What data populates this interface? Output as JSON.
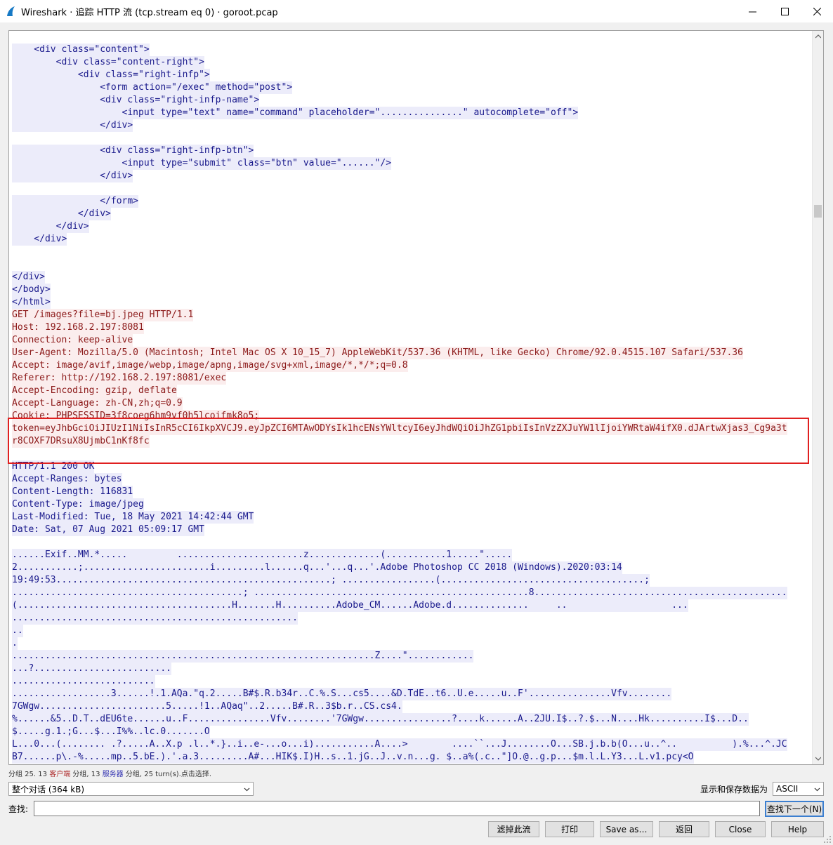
{
  "window": {
    "title": "Wireshark · 追踪 HTTP 流 (tcp.stream eq 0) · goroot.pcap"
  },
  "colors": {
    "server_bg": "#ececfa",
    "server_fg": "#1a1a8c",
    "client_bg": "#fbeded",
    "client_fg": "#8c1a1a",
    "highlight_border": "#e02020"
  },
  "stream": {
    "lines": [
      {
        "t": "s",
        "text": "    <div class=\"content\">"
      },
      {
        "t": "s",
        "text": "        <div class=\"content-right\">"
      },
      {
        "t": "s",
        "text": "            <div class=\"right-infp\">"
      },
      {
        "t": "s",
        "text": "                <form action=\"/exec\" method=\"post\">"
      },
      {
        "t": "s",
        "text": "                <div class=\"right-infp-name\">"
      },
      {
        "t": "s",
        "text": "                    <input type=\"text\" name=\"command\" placeholder=\"...............\" autocomplete=\"off\">"
      },
      {
        "t": "s",
        "text": "                </div>"
      },
      {
        "t": "s",
        "text": ""
      },
      {
        "t": "s",
        "text": "                <div class=\"right-infp-btn\">"
      },
      {
        "t": "s",
        "text": "                    <input type=\"submit\" class=\"btn\" value=\"......\"/>"
      },
      {
        "t": "s",
        "text": "                </div>"
      },
      {
        "t": "s",
        "text": ""
      },
      {
        "t": "s",
        "text": "                </form>"
      },
      {
        "t": "s",
        "text": "            </div>"
      },
      {
        "t": "s",
        "text": "        </div>"
      },
      {
        "t": "s",
        "text": "    </div>"
      },
      {
        "t": "s",
        "text": ""
      },
      {
        "t": "s",
        "text": ""
      },
      {
        "t": "s",
        "text": "</div>"
      },
      {
        "t": "s",
        "text": "</body>"
      },
      {
        "t": "s",
        "text": "</html>"
      },
      {
        "t": "c",
        "text": "GET /images?file=bj.jpeg HTTP/1.1"
      },
      {
        "t": "c",
        "text": "Host: 192.168.2.197:8081"
      },
      {
        "t": "c",
        "text": "Connection: keep-alive"
      },
      {
        "t": "c",
        "text": "User-Agent: Mozilla/5.0 (Macintosh; Intel Mac OS X 10_15_7) AppleWebKit/537.36 (KHTML, like Gecko) Chrome/92.0.4515.107 Safari/537.36"
      },
      {
        "t": "c",
        "text": "Accept: image/avif,image/webp,image/apng,image/svg+xml,image/*,*/*;q=0.8"
      },
      {
        "t": "c",
        "text": "Referer: http://192.168.2.197:8081/exec"
      },
      {
        "t": "c",
        "text": "Accept-Encoding: gzip, deflate"
      },
      {
        "t": "c",
        "text": "Accept-Language: zh-CN,zh;q=0.9"
      },
      {
        "t": "c",
        "text": "Cookie: PHPSESSID=3f8coeg6hm9vf0h5lcoifmk8o5;"
      },
      {
        "t": "c",
        "text": "token=eyJhbGciOiJIUzI1NiIsInR5cCI6IkpXVCJ9.eyJpZCI6MTAwODYsIk1hcENsYWltcyI6eyJhdWQiOiJhZG1pbiIsInVzZXJuYW1lIjoiYWRtaW4ifX0.dJArtwXjas3_Cg9a3t"
      },
      {
        "t": "c",
        "text": "r8COXF7DRsuX8UjmbC1nKf8fc"
      },
      {
        "t": "c",
        "text": ""
      },
      {
        "t": "s",
        "text": "HTTP/1.1 200 OK"
      },
      {
        "t": "s",
        "text": "Accept-Ranges: bytes"
      },
      {
        "t": "s",
        "text": "Content-Length: 116831"
      },
      {
        "t": "s",
        "text": "Content-Type: image/jpeg"
      },
      {
        "t": "s",
        "text": "Last-Modified: Tue, 18 May 2021 14:42:44 GMT"
      },
      {
        "t": "s",
        "text": "Date: Sat, 07 Aug 2021 05:09:17 GMT"
      },
      {
        "t": "s",
        "text": ""
      },
      {
        "t": "s",
        "text": "......Exif..MM.*.....         .......................z.............(...........1.....\"....."
      },
      {
        "t": "s",
        "text": "2...........;.......................i.........l......q...'...q...'.Adobe Photoshop CC 2018 (Windows).2020:03:14"
      },
      {
        "t": "s",
        "text": "19:49:53..................................................; .................(.....................................;"
      },
      {
        "t": "s",
        "text": "..........................................; ..................................................8.............................................."
      },
      {
        "t": "s",
        "text": "(.......................................H.......H..........Adobe_CM......Adobe.d..............     ..                   ..."
      },
      {
        "t": "s",
        "text": "...................................................."
      },
      {
        "t": "s",
        "text": ".."
      },
      {
        "t": "s",
        "text": "."
      },
      {
        "t": "s",
        "text": "..................................................................Z....\"............"
      },
      {
        "t": "s",
        "text": "...?........................."
      },
      {
        "t": "s",
        "text": ".........................."
      },
      {
        "t": "s",
        "text": "..................3......!.1.AQa.\"q.2.....B#$.R.b34r..C.%.S...cs5....&D.TdE..t6..U.e.....u..F'...............Vfv........"
      },
      {
        "t": "s",
        "text": "7GWgw.......................5.....!1..AQaq\"..2.....B#.R..3$b.r..CS.cs4."
      },
      {
        "t": "s",
        "text": "%......&5..D.T..dEU6te......u..F...............Vfv........'7GWgw................?....k......A..2JU.I$..?.$...N....Hk..........I$...D.."
      },
      {
        "t": "s",
        "text": "$.....g.1.;G...$...I%%..lc.0.......O"
      },
      {
        "t": "s",
        "text": "L...0...(........ .?.....A..X.p .l..*.}..i..e-...o...i)...........A....>        ....``...J........O...SB.j.b.b(O...u..^..          ).%...^.JC"
      },
      {
        "t": "s",
        "text": "B7......p\\.-%.....mp..5.bE.).'.a.3.........A#...HIK$.I)H..s..1.jG..J..v.n...g. $..a%(.c..\"]O.@..g.p...$m.l.L.Y3...L.v1.pcy<O"
      }
    ]
  },
  "status": {
    "part1": "分组 25.",
    "client_count": "13",
    "client_word": "客户端",
    "part2": "分组,",
    "server_count": "13",
    "server_word": "服务器",
    "part3": "分组, 25 turn(s).点击选择."
  },
  "conversation_select": {
    "value": "整个对话 (364 kB)"
  },
  "show_as": {
    "label": "显示和保存数据为",
    "value": "ASCII"
  },
  "find": {
    "label": "查找:",
    "value": "",
    "next_label": "查找下一个(N)"
  },
  "buttons": {
    "filter_out": "滤掉此流",
    "print": "打印",
    "save_as": "Save as…",
    "back": "返回",
    "close": "Close",
    "help": "Help"
  }
}
